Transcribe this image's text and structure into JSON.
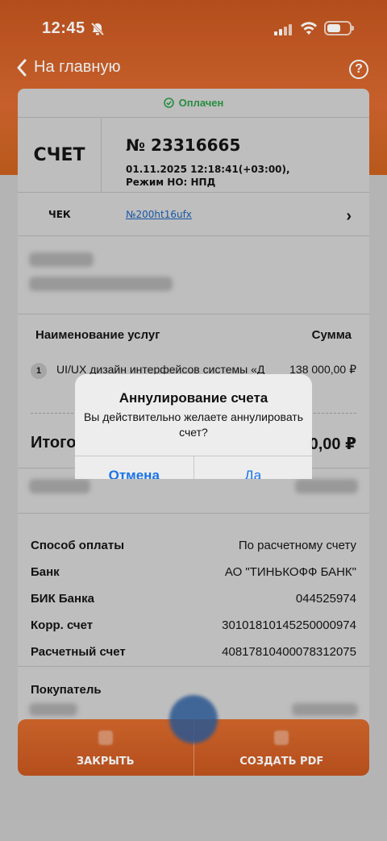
{
  "status_bar": {
    "time": "12:45"
  },
  "nav": {
    "back_label": "На главную",
    "help_label": "?"
  },
  "invoice": {
    "status": "Оплачен",
    "doc_type": "СЧЕТ",
    "number": "№ 23316665",
    "datetime": "01.11.2025 12:18:41(+03:00),",
    "tax_mode": "Режим НО: НПД",
    "cheque_label": "ЧЕК",
    "cheque_link": "№200ht16ufx"
  },
  "services": {
    "header_name": "Наименование услуг",
    "header_sum": "Сумма",
    "items": [
      {
        "index": "1",
        "name": "UI/UX дизайн интерфейсов системы «Д",
        "amount": "138 000,00 ₽"
      }
    ],
    "total_label": "Итого",
    "total_value": "0,00 ₽"
  },
  "payment": {
    "rows": [
      {
        "key": "Способ оплаты",
        "value": "По расчетному счету"
      },
      {
        "key": "Банк",
        "value": "АО \"ТИНЬКОФФ БАНК\""
      },
      {
        "key": "БИК Банка",
        "value": "044525974"
      },
      {
        "key": "Корр. счет",
        "value": "30101810145250000974"
      },
      {
        "key": "Расчетный счет",
        "value": "40817810400078312075"
      }
    ],
    "buyer_label": "Покупатель"
  },
  "bottom_bar": {
    "close_label": "ЗАКРЫТЬ",
    "pdf_label": "СОЗДАТЬ PDF"
  },
  "alert": {
    "title": "Аннулирование счета",
    "message": "Вы действительно желаете аннулировать счет?",
    "cancel_label": "Отмена",
    "confirm_label": "Да"
  },
  "colors": {
    "accent": "#d7682f",
    "paid": "#2b9a46",
    "link": "#1a5fb4",
    "alert_button": "#1a73e8"
  }
}
